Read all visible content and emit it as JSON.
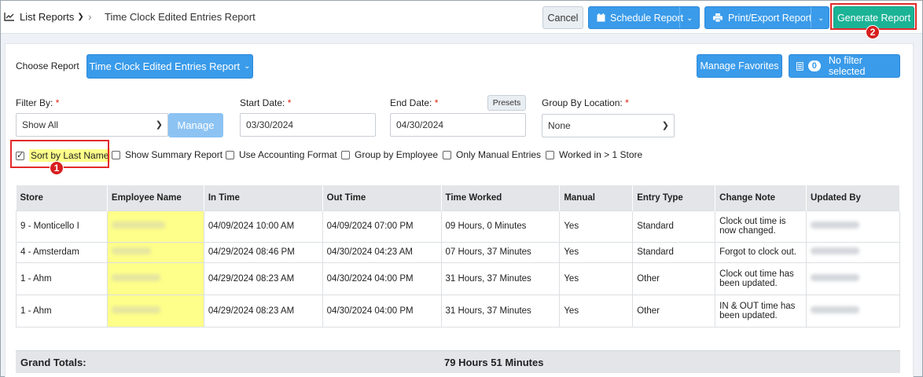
{
  "header": {
    "list_label": "List Reports",
    "current_page": "Time Clock Edited Entries Report",
    "cancel": "Cancel",
    "schedule": "Schedule Report",
    "print": "Print/Export Report",
    "generate": "Generate Report"
  },
  "callouts": [
    "1",
    "2"
  ],
  "controls": {
    "choose_label": "Choose Report",
    "choose_value": "Time Clock Edited Entries Report",
    "manage_favorites": "Manage Favorites",
    "filter_count": "0",
    "filter_label": "No filter selected",
    "filter_by_label": "Filter By:",
    "filter_by_value": "Show All",
    "manage": "Manage",
    "start_label": "Start Date:",
    "start_value": "03/30/2024",
    "end_label": "End Date:",
    "end_value": "04/30/2024",
    "presets": "Presets",
    "group_loc_label": "Group By Location:",
    "group_loc_value": "None",
    "required_mark": "*"
  },
  "options": [
    {
      "label": "Sort by Last Name",
      "checked": true
    },
    {
      "label": "Show Summary Report",
      "checked": false
    },
    {
      "label": "Use Accounting Format",
      "checked": false
    },
    {
      "label": "Group by Employee",
      "checked": false
    },
    {
      "label": "Only Manual Entries",
      "checked": false
    },
    {
      "label": "Worked in > 1 Store",
      "checked": false
    }
  ],
  "table": {
    "headers": [
      "Store",
      "Employee Name",
      "In Time",
      "Out Time",
      "Time Worked",
      "Manual",
      "Entry Type",
      "Change Note",
      "Updated By"
    ],
    "rows": [
      {
        "store": "9 - Monticello I",
        "in": "04/09/2024 10:00 AM",
        "out": "04/09/2024 07:00 PM",
        "worked": "09 Hours, 0 Minutes",
        "manual": "Yes",
        "type": "Standard",
        "note": "Clock out time is now changed."
      },
      {
        "store": "4 - Amsterdam",
        "in": "04/29/2024 08:46 PM",
        "out": "04/30/2024 04:23 AM",
        "worked": "07 Hours, 37 Minutes",
        "manual": "Yes",
        "type": "Standard",
        "note": "Forgot to clock out."
      },
      {
        "store": "1 - Ahm",
        "in": "04/29/2024 08:23 AM",
        "out": "04/30/2024 04:00 PM",
        "worked": "31 Hours, 37 Minutes",
        "manual": "Yes",
        "type": "Other",
        "note": "Clock out time has been updated."
      },
      {
        "store": "1 - Ahm",
        "in": "04/29/2024 08:23 AM",
        "out": "04/30/2024 04:00 PM",
        "worked": "31 Hours, 37 Minutes",
        "manual": "Yes",
        "type": "Other",
        "note": "IN & OUT time has been updated."
      }
    ],
    "totals_label": "Grand Totals:",
    "totals_value": "79 Hours 51 Minutes"
  },
  "colors": {
    "primary": "#3a9bea",
    "generate": "#1bb396",
    "highlight": "#fefe8a",
    "callout": "#d81f1f"
  }
}
